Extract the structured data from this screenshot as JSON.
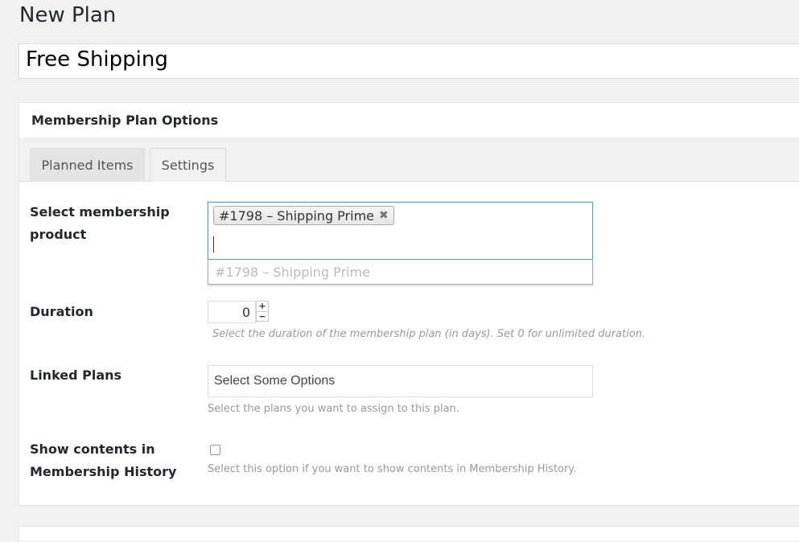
{
  "page": {
    "title": "New Plan"
  },
  "plan_title": {
    "value": "Free Shipping"
  },
  "postbox": {
    "heading": "Membership Plan Options",
    "tabs": [
      {
        "label": "Planned Items",
        "state": "inactive"
      },
      {
        "label": "Settings",
        "state": "active"
      }
    ]
  },
  "fields": {
    "product": {
      "label": "Select membership product",
      "selected_chip": "#1798 – Shipping Prime",
      "remove_icon": "close-icon",
      "dropdown_option": "#1798 – Shipping Prime"
    },
    "duration": {
      "label": "Duration",
      "value": "0",
      "help": "Select the duration of the membership plan (in days). Set 0 for unlimited duration.",
      "up": "+",
      "down": "−"
    },
    "linked_plans": {
      "label": "Linked Plans",
      "placeholder": "Select Some Options",
      "help": "Select the plans you want to assign to this plan."
    },
    "show_contents": {
      "label": "Show contents in Membership History",
      "checked": false,
      "help": "Select this option if you want to show contents in Membership History."
    }
  },
  "colors": {
    "background": "#f1f1f1",
    "focus_border": "#5b9dd9"
  }
}
